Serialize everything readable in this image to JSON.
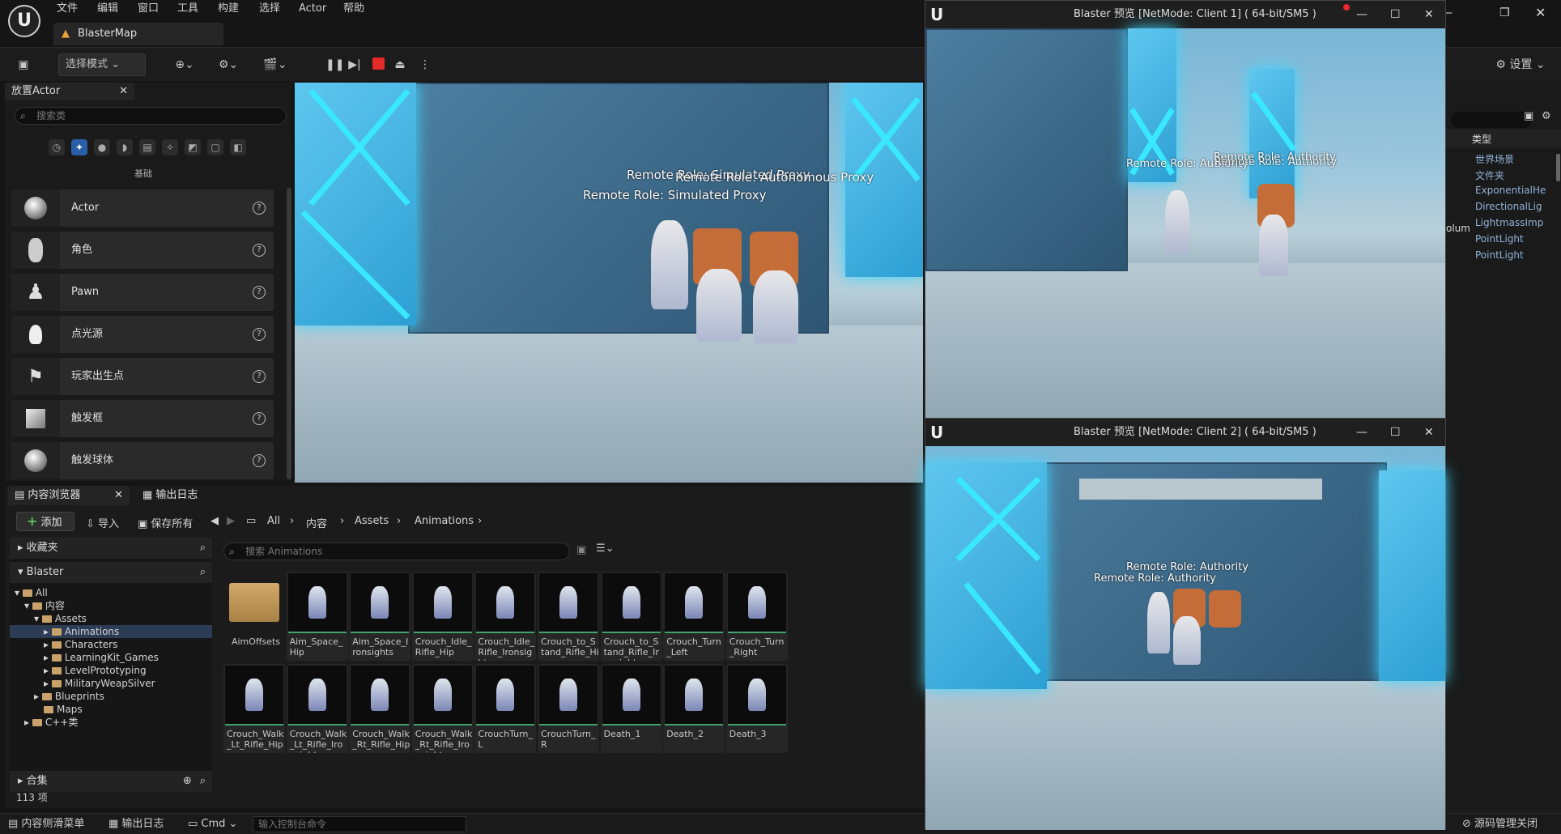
{
  "menu": [
    "文件",
    "编辑",
    "窗口",
    "工具",
    "构建",
    "选择",
    "Actor",
    "帮助"
  ],
  "map_tab": "BlasterMap",
  "toolbar": {
    "mode_label": "选择模式",
    "settings_label": "设置"
  },
  "place_actors": {
    "title": "放置Actor",
    "search_placeholder": "搜索类",
    "category": "基础",
    "items": [
      "Actor",
      "角色",
      "Pawn",
      "点光源",
      "玩家出生点",
      "触发框",
      "触发球体"
    ]
  },
  "viewport_main": {
    "labels": [
      "Remote Role: Simulated Proxy",
      "Remote Role: Autonomous Proxy",
      "Remote Role: Simulated Proxy"
    ]
  },
  "client1": {
    "title": "Blaster 预览 [NetMode: Client 1]   ( 64-bit/SM5 )",
    "labels": [
      "Remote Role: Authority",
      "Remote Role: Authority",
      "Remote Role: Authority"
    ]
  },
  "client2": {
    "title": "Blaster 预览 [NetMode: Client 2]   ( 64-bit/SM5 )",
    "labels": [
      "Remote Role: Authority",
      "Remote Role: Authority"
    ]
  },
  "content_browser": {
    "tab": "内容浏览器",
    "log_tab": "输出日志",
    "add": "添加",
    "import": "导入",
    "save_all": "保存所有",
    "breadcrumb": [
      "All",
      "内容",
      "Assets",
      "Animations"
    ],
    "favorites": "收藏夹",
    "project": "Blaster",
    "collections": "合集",
    "search_placeholder": "搜索 Animations",
    "tree": [
      "All",
      "内容",
      "Assets",
      "Animations",
      "Characters",
      "LearningKit_Games",
      "LevelPrototyping",
      "MilitaryWeapSilver",
      "Blueprints",
      "Maps",
      "C++类"
    ],
    "row1": [
      "AimOffsets",
      "Aim_Space_Hip",
      "Aim_Space_Ironsights",
      "Crouch_Idle_Rifle_Hip",
      "Crouch_Idle_Rifle_Ironsights",
      "Crouch_to_Stand_Rifle_Hip",
      "Crouch_to_Stand_Rifle_Ironsights",
      "Crouch_Turn_Left",
      "Crouch_Turn_Right"
    ],
    "row2": [
      "Crouch_Walk_Lt_Rifle_Hip",
      "Crouch_Walk_Lt_Rifle_Ironsights",
      "Crouch_Walk_Rt_Rifle_Hip",
      "Crouch_Walk_Rt_Rifle_Ironsights",
      "CrouchTurn_L",
      "CrouchTurn_R",
      "Death_1",
      "Death_2",
      "Death_3"
    ],
    "count": "113 项"
  },
  "status": {
    "drawer": "内容侧滑菜单",
    "log": "输出日志",
    "cmd": "Cmd",
    "cmd_placeholder": "输入控制台命令",
    "source_control": "源码管理关闭"
  },
  "outliner": {
    "header": "类型",
    "volume_text": "olum",
    "types": [
      "世界场景",
      "文件夹",
      "ExponentialHe",
      "DirectionalLig",
      "LightmassImp",
      "PointLight",
      "PointLight"
    ]
  }
}
